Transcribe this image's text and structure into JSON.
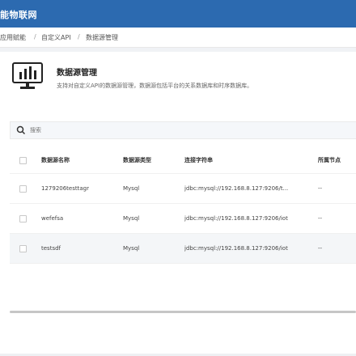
{
  "app": {
    "brand": "能物联网"
  },
  "breadcrumb": {
    "items": [
      "应用赋能",
      "自定义API",
      "数据源管理"
    ],
    "separator": "/"
  },
  "header": {
    "title": "数据源管理",
    "description": "支持对自定义API的数据源管理，数据源包括平台的关系数据库和时序数据库。",
    "icon": "monitor-chart-icon"
  },
  "search": {
    "placeholder": "搜索",
    "icon": "search-icon"
  },
  "table": {
    "columns": [
      "数据源名称",
      "数据源类型",
      "连接字符串",
      "所属节点"
    ],
    "rows": [
      {
        "name": "1279206testtagr",
        "type": "Mysql",
        "conn": "jdbc:mysql://192.168.8.127:9206/t...",
        "node": "--"
      },
      {
        "name": "wefefsa",
        "type": "Mysql",
        "conn": "jdbc:mysql://192.168.8.127:9206/iot",
        "node": "--"
      },
      {
        "name": "testsdf",
        "type": "Mysql",
        "conn": "jdbc:mysql://192.168.8.127:9206/iot",
        "node": "--"
      }
    ]
  },
  "colors": {
    "topbar": "#2c6ab0",
    "highlight_row": "#f4f6f8"
  }
}
